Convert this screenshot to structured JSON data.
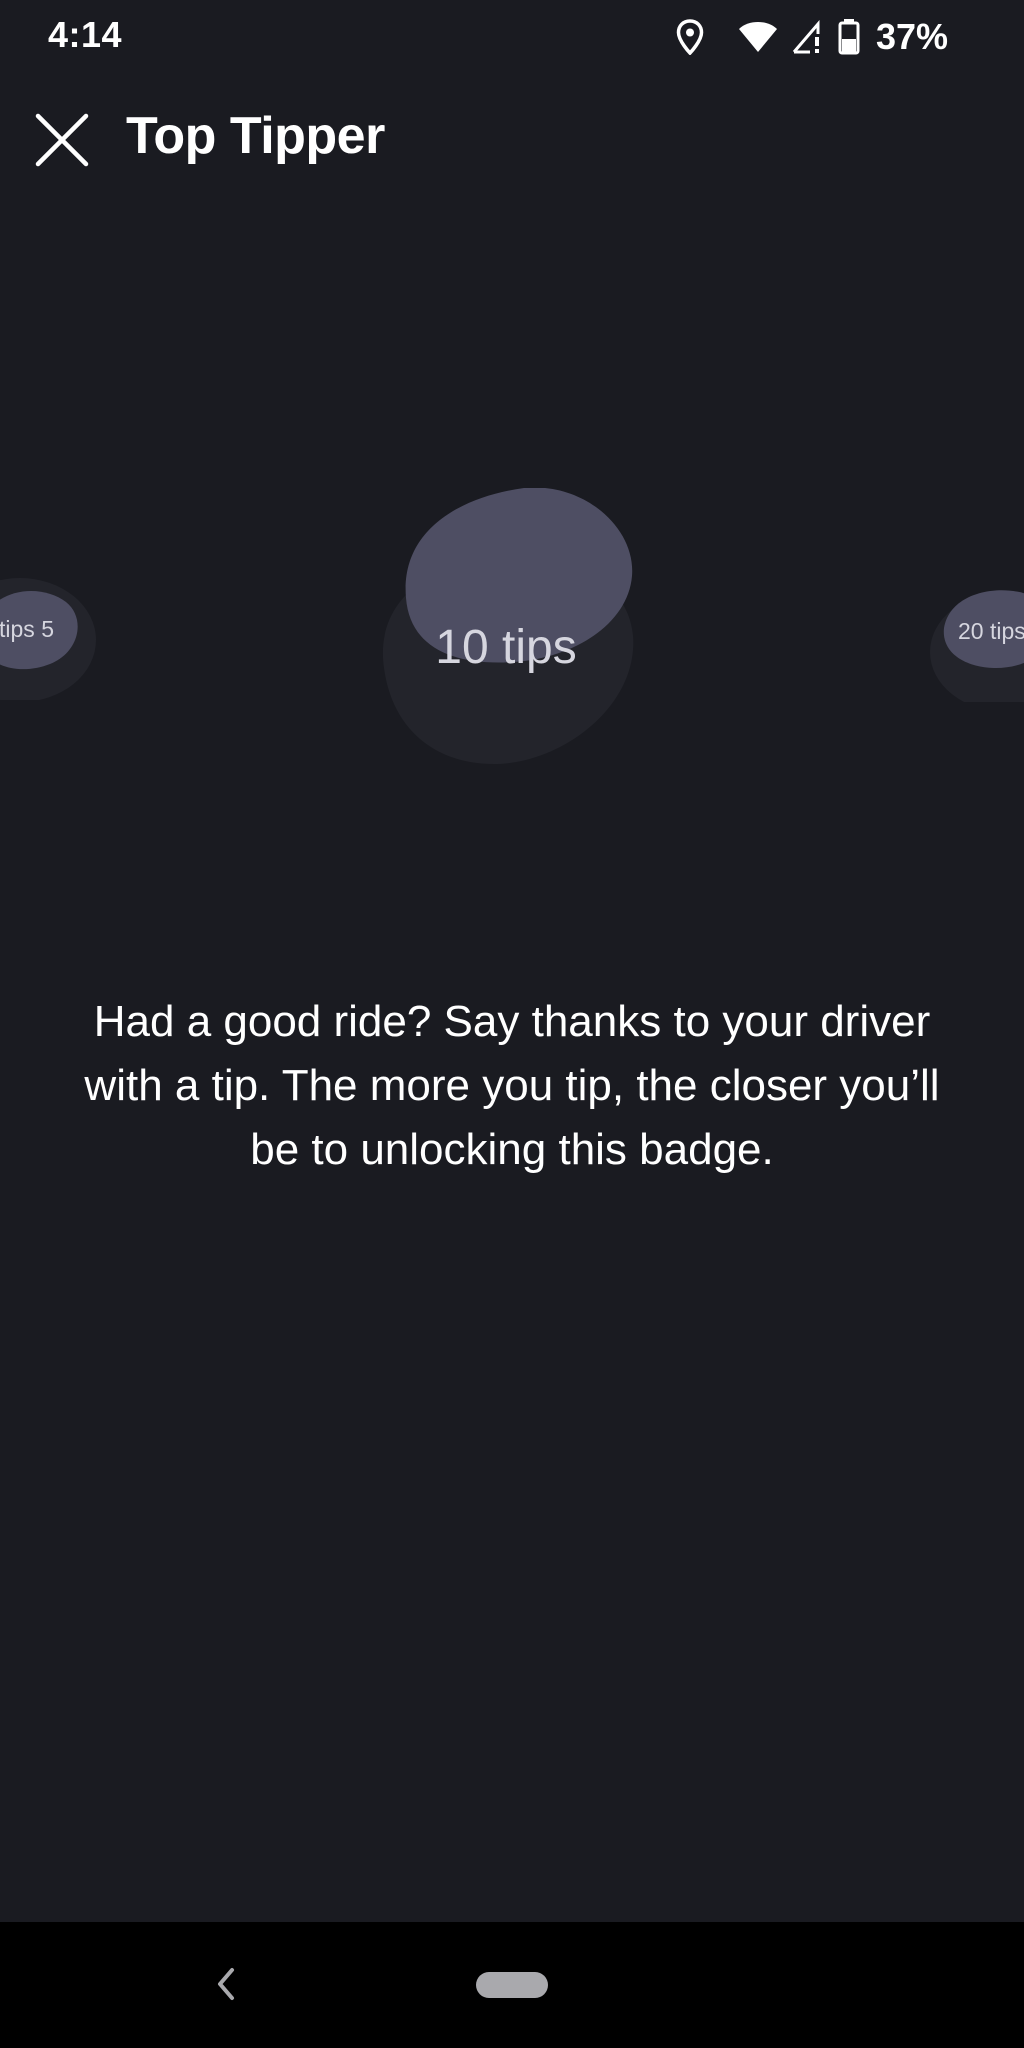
{
  "status_bar": {
    "time": "4:14",
    "battery_percent": "37%",
    "icons": [
      "location-icon",
      "wifi-icon",
      "signal-icon",
      "battery-icon"
    ]
  },
  "header": {
    "title": "Top Tipper",
    "close_icon": "close-icon"
  },
  "badges": {
    "previous": "5 tips",
    "current": "10 tips",
    "next": "20 tips"
  },
  "description": "Had a good ride? Say thanks to your driver with a tip. The more you tip, the closer you’ll be to unlocking this badge.",
  "nav_bar": {
    "back_icon": "back-icon",
    "home_icon": "home-pill-icon"
  },
  "colors": {
    "background": "#1a1b21",
    "badge_fill": "#4e4e63",
    "badge_shadow": "#23242b",
    "text": "#ffffff",
    "badge_text": "#d6d6df"
  }
}
